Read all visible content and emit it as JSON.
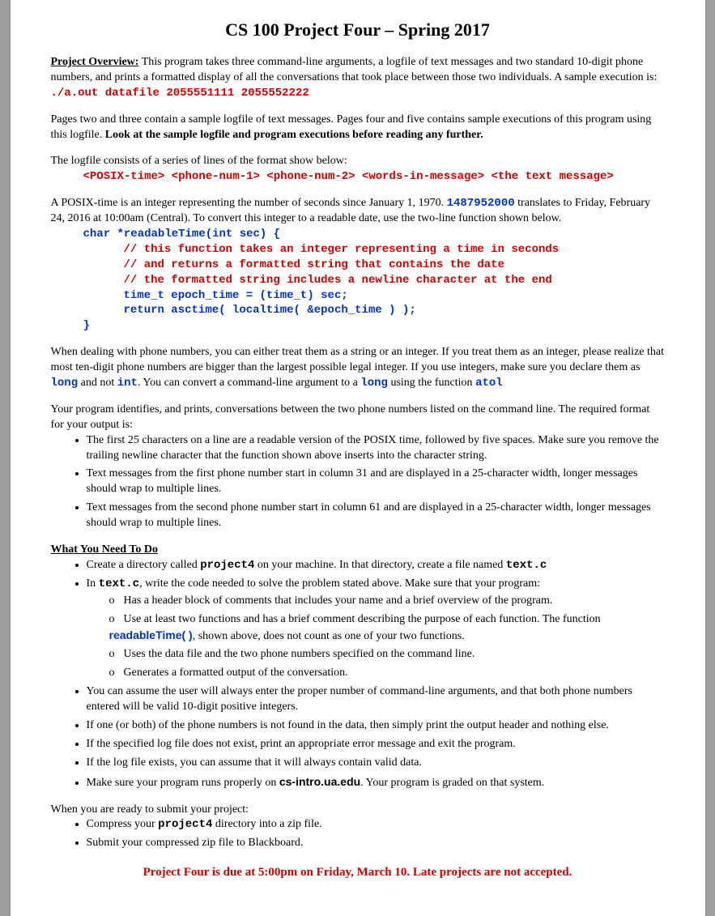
{
  "title": "CS 100 Project Four – Spring 2017",
  "overviewLabel": "Project Overview:",
  "overviewText1": " This program takes three command-line arguments, a logfile of text messages and two standard 10-digit phone numbers, and prints a formatted display of all the conversations that took place between those two individuals.  A sample execution is: ",
  "sampleExec": "./a.out datafile 2055551111 2055552222",
  "pagesNote1": "Pages two and three contain a sample logfile of text messages.  Pages four and five contains sample executions of this program using this logfile.  ",
  "pagesNote2": "Look at the sample logfile and program executions before reading any further.",
  "logfileIntro": "The logfile consists of a series of lines of the format show below:",
  "logfileFormat": "<POSIX-time> <phone-num-1> <phone-num-2> <words-in-message>  <the text message>",
  "posix1": "A POSIX-time is an integer representing the number of seconds since January 1, 1970. ",
  "posixExample": "1487952000",
  "posix2": " translates to Friday, February 24, 2016 at 10:00am (Central).  To convert this integer to a readable date, use the two-line function shown below.",
  "code": {
    "l1": "char *readableTime(int sec) {",
    "l2": "// this function takes an integer representing a time in seconds",
    "l3": "// and returns a formatted string that contains the date",
    "l4": "// the formatted string includes a newline character at the end",
    "l5": "time_t epoch_time = (time_t) sec;",
    "l6": "return asctime( localtime( &epoch_time ) );",
    "l7": "}"
  },
  "phone1": "When dealing with phone numbers, you can either treat them as a string or an integer.  If you treat them as an integer, please realize that most ten-digit phone numbers are bigger than the largest possible legal integer.  If you use integers, make sure you declare them as ",
  "long": "long",
  "phone2": " and not ",
  "int": "int",
  "phone3": ".  You can convert a command-line argument to a ",
  "phone4": " using the function ",
  "atol": "atol",
  "identifyIntro": "Your program identifies, and prints, conversations between the two phone numbers listed on the command line.  The required format for your output is:",
  "outItems": [
    "The first 25 characters on a line are a readable version of the POSIX time, followed by five spaces.  Make sure you remove the trailing newline character that the function shown above inserts into the character string.",
    "Text messages from the first phone number start in column 31 and are displayed in a 25-character width, longer messages should wrap to multiple lines.",
    "Text messages from the second phone number start in column 61 and are displayed in a 25-character width, longer messages should wrap to multiple lines."
  ],
  "whatHeading": "What You Need To Do",
  "needItem1a": "Create a directory called ",
  "project4": "project4",
  "needItem1b": " on your machine.  In that directory, create a file named ",
  "textc": "text.c",
  "needItem2a": "In ",
  "needItem2b": ", write the code needed to solve the problem stated above.  Make sure that your program:",
  "sub1": "Has a header block of comments that includes your name and a brief overview of the program.",
  "sub2a": "Use at least two functions and has a brief comment describing the purpose of each function.  The function ",
  "readableTime": "readableTime( )",
  "sub2b": ", shown above, does not count as one of your two functions.",
  "sub3": "Uses the data file and the two phone numbers specified on the command line.",
  "sub4": "Generates a formatted output of the conversation.",
  "needItem3": "You can assume the user will always enter the proper number of command-line arguments, and that both phone numbers entered will be valid 10-digit positive integers.",
  "needItem4": "If one (or both) of the phone numbers is not found in the data, then simply print the output header and nothing else.",
  "needItem5": "If the specified log file does not exist, print an appropriate error message and exit the program.",
  "needItem6": "If the log file exists, you can assume that it will always contain valid data.",
  "needItem7a": "Make sure your program runs properly on ",
  "csintro": "cs-intro.ua.edu",
  "needItem7b": ".  Your program is graded on that system.",
  "submitIntro": "When you are ready to submit your project:",
  "submit1a": "Compress your ",
  "submit1b": " directory into a zip file.",
  "submit2": "Submit your compressed zip file to Blackboard.",
  "dueLine": "Project Four is due at 5:00pm on Friday, March 10.  Late projects are not accepted."
}
